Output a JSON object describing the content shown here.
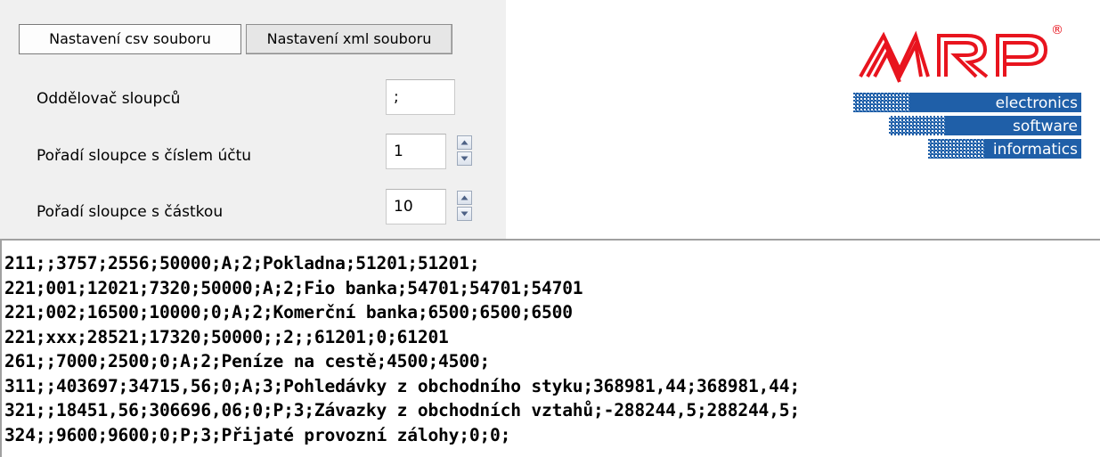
{
  "tabs": [
    {
      "label": "Nastavení csv souboru",
      "active": true
    },
    {
      "label": "Nastavení xml souboru",
      "active": false
    }
  ],
  "fields": {
    "separator": {
      "label": "Oddělovač sloupců",
      "value": ";"
    },
    "account_column": {
      "label": "Pořadí sloupce s číslem účtu",
      "value": "1"
    },
    "amount_column": {
      "label": "Pořadí sloupce s částkou",
      "value": "10"
    }
  },
  "logo": {
    "brand": "MRP",
    "registered": "®",
    "lines": [
      "electronics",
      "software",
      "informatics"
    ],
    "brand_color": "#e8141e",
    "band_color": "#1f5fa8"
  },
  "code_lines": [
    "211;;3757;2556;50000;A;2;Pokladna;51201;51201;",
    "221;001;12021;7320;50000;A;2;Fio banka;54701;54701;54701",
    "221;002;16500;10000;0;A;2;Komerční banka;6500;6500;6500",
    "221;xxx;28521;17320;50000;;2;;61201;0;61201",
    "261;;7000;2500;0;A;2;Peníze na cestě;4500;4500;",
    "311;;403697;34715,56;0;A;3;Pohledávky z obchodního styku;368981,44;368981,44;",
    "321;;18451,56;306696,06;0;P;3;Závazky z obchodních vztahů;-288244,5;288244,5;",
    "324;;9600;9600;0;P;3;Přijaté provozní zálohy;0;0;"
  ]
}
